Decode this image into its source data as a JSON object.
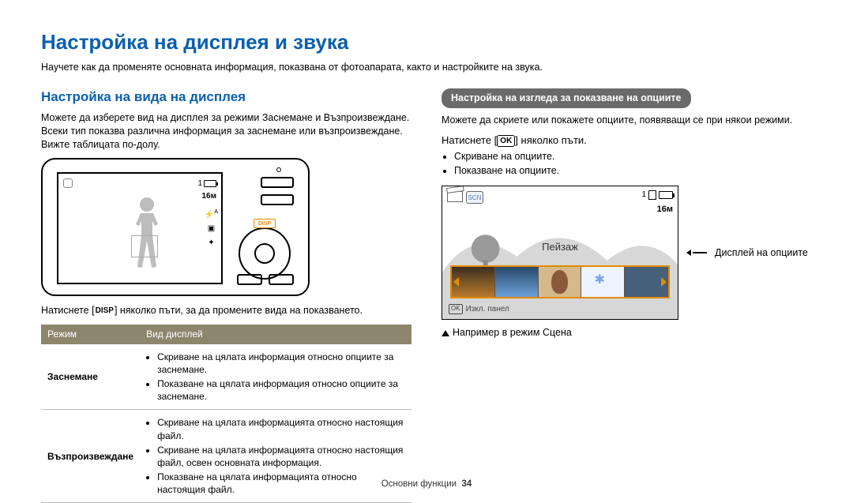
{
  "page": {
    "title": "Настройка на дисплея и звука",
    "intro": "Научете как да променяте основната информация, показвана от фотоапарата, както и настройките на звука."
  },
  "left": {
    "heading": "Настройка на вида на дисплея",
    "p1": "Можете да изберете вид на дисплея за режими Заснемане и Възпроизвеждане. Всеки тип показва различна информация за заснемане или възпроизвеждане. Вижте таблицата по-долу.",
    "camera": {
      "disp_label": "DISP",
      "res_label": "16м",
      "top_right_count": "1"
    },
    "press_disp_prefix": "Натиснете [",
    "press_disp_token": "DISP",
    "press_disp_suffix": "] няколко пъти, за да промените вида на показването.",
    "table": {
      "h_mode": "Режим",
      "h_type": "Вид дисплей",
      "row1_label": "Заснемане",
      "row1_items": [
        "Скриване на цялата информация относно опциите за заснемане.",
        "Показване на цялата информация относно опциите за заснемане."
      ],
      "row2_label": "Възпроизвеждане",
      "row2_items": [
        "Скриване на цялата информацията относно настоящия файл.",
        "Скриване на цялата информацията относно настоящия файл, освен основната информация.",
        "Показване на цялата информацията относно настоящия файл."
      ]
    }
  },
  "right": {
    "pill": "Настройка на изгледа за показване на опциите",
    "p1": "Можете да скриете или покажете опциите, появяващи се при някои режими.",
    "press_ok_prefix": "Натиснете [",
    "press_ok_token": "OK",
    "press_ok_suffix": "] няколко пъти.",
    "bullets": [
      "Скриване на опциите.",
      "Показване на опциите."
    ],
    "scene": {
      "scn_badge": "SCN",
      "top_count": "1",
      "res_label": "16м",
      "center_label": "Пейзаж",
      "footer_ok": "OK",
      "footer_text": "Изкл. панел"
    },
    "options_caption": "Дисплей на опциите",
    "example_line": "Например в режим Сцена"
  },
  "footer": {
    "section": "Основни функции",
    "page_num": "34"
  }
}
